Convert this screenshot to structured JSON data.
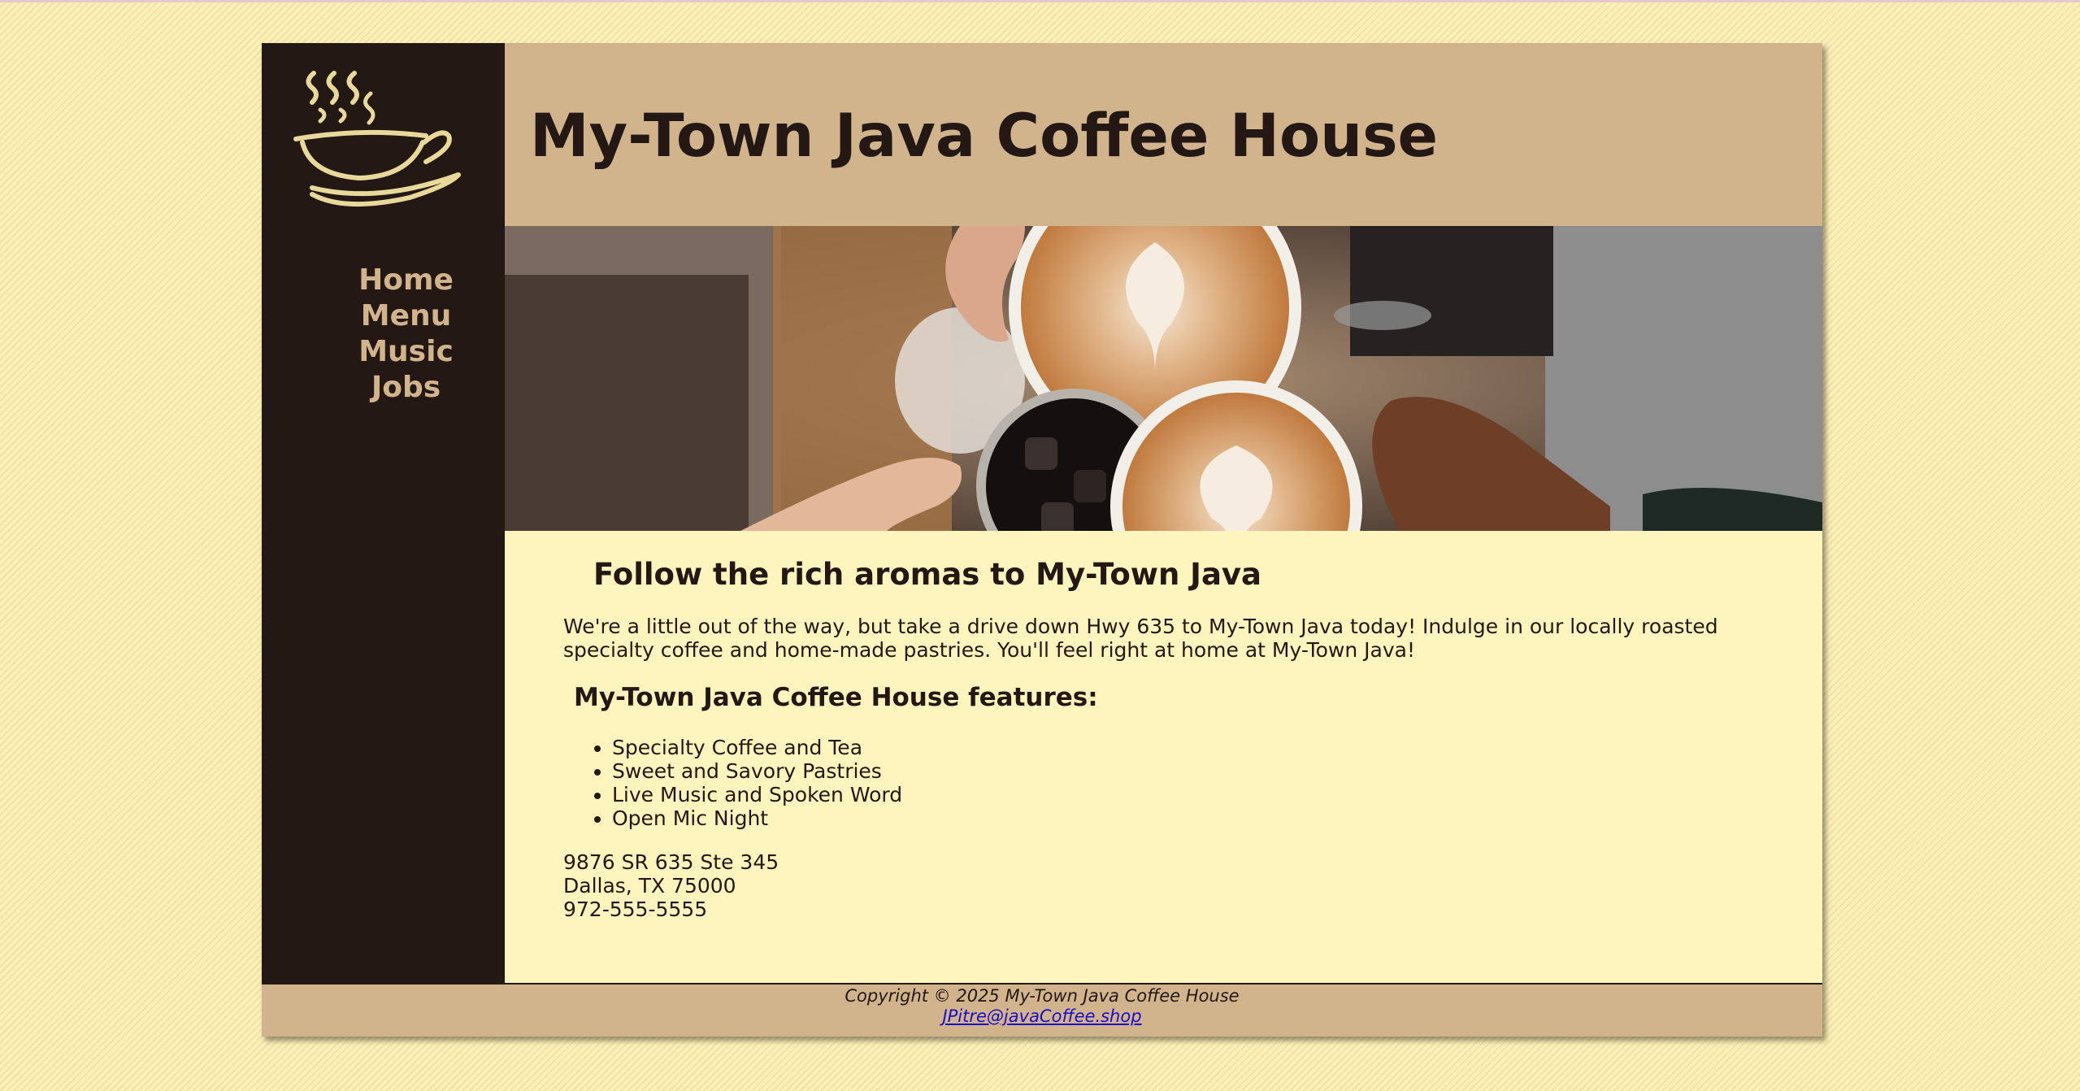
{
  "header": {
    "title": "My-Town Java Coffee House"
  },
  "sidebar": {
    "logo_icon": "steaming-coffee-cup-icon",
    "nav": [
      {
        "label": "Home"
      },
      {
        "label": "Menu"
      },
      {
        "label": "Music"
      },
      {
        "label": "Jobs"
      }
    ]
  },
  "hero": {
    "image": "four-hands-holding-coffee-cups-photo"
  },
  "main": {
    "heading": "Follow the rich aromas to My-Town Java",
    "intro": "We're a little out of the way, but take a drive down Hwy 635 to My-Town Java today! Indulge in our locally roasted specialty coffee and home-made pastries. You'll feel right at home at My-Town Java!",
    "features_heading": "My-Town Java Coffee House features:",
    "features": [
      "Specialty Coffee and Tea",
      "Sweet and Savory Pastries",
      "Live Music and Spoken Word",
      "Open Mic Night"
    ],
    "address": {
      "street": "9876 SR 635 Ste 345",
      "city": "Dallas, TX 75000",
      "phone": "972-555-5555"
    }
  },
  "footer": {
    "copyright": "Copyright © 2025 My-Town Java Coffee House",
    "email": "JPitre@javaCoffee.shop"
  },
  "colors": {
    "dark_brown": "#231814",
    "tan": "#d2b48c",
    "cream": "#fdf5bd",
    "page_background": "#faf0b8",
    "link": "#1a0dcc"
  }
}
